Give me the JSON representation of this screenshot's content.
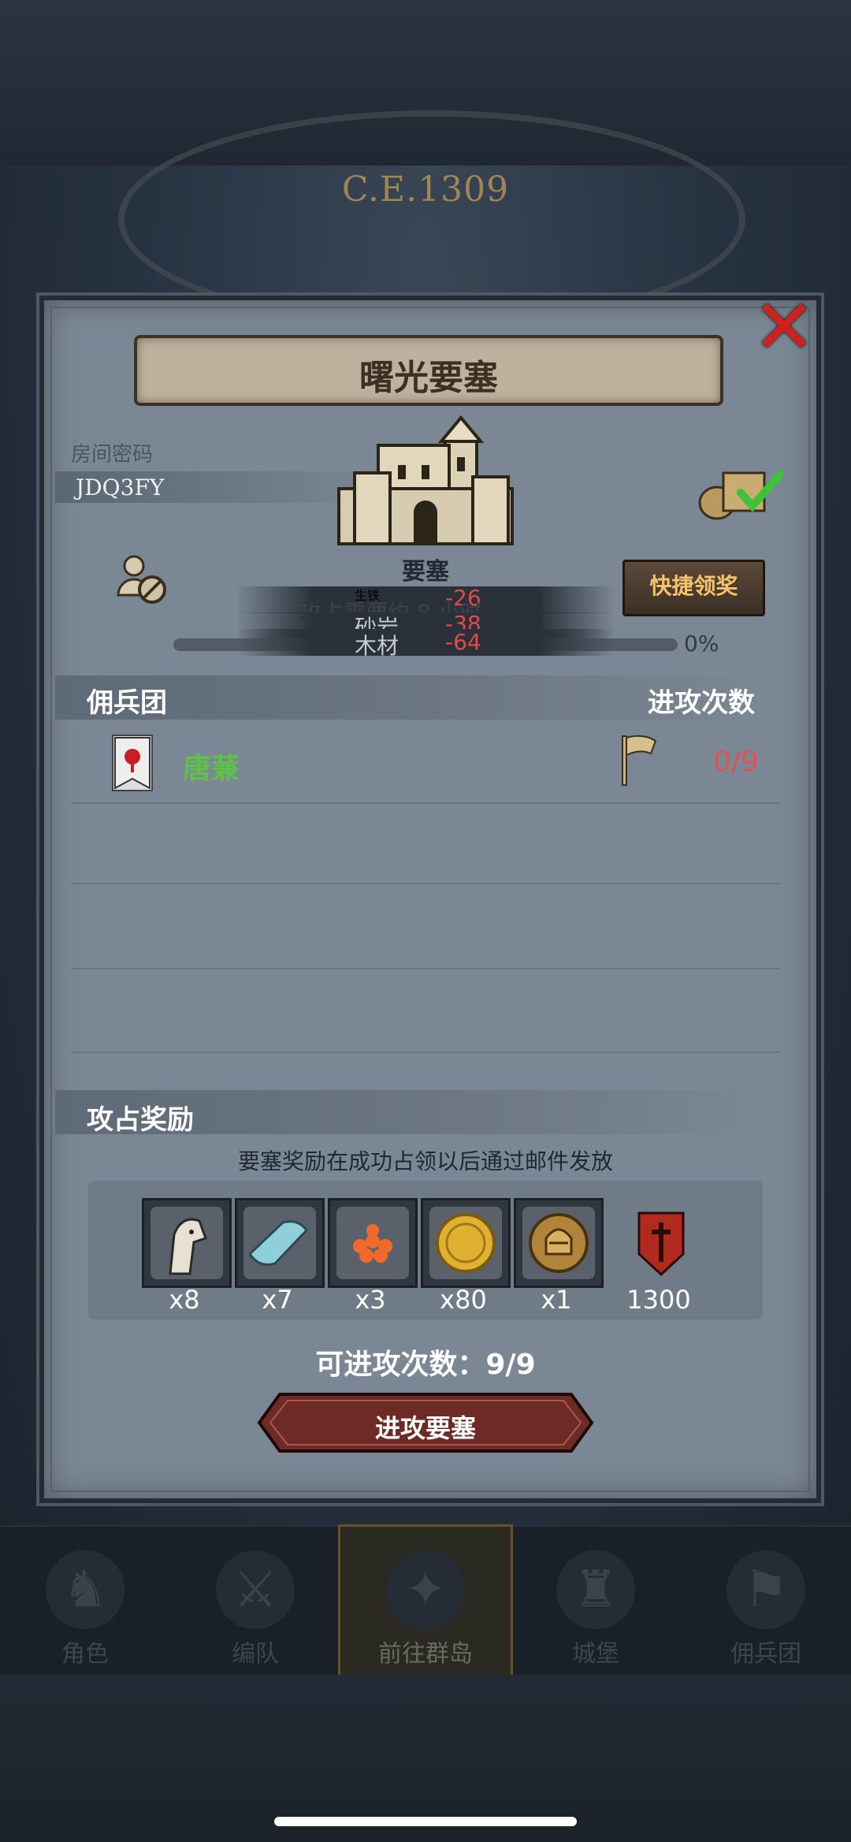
{
  "background": {
    "era": "C.E.1309"
  },
  "dialog": {
    "title": "曙光要塞",
    "room_label": "房间密码",
    "room_code": "JDQ3FY",
    "fortress_label": "要塞",
    "quick_claim_label": "快捷领奖",
    "progress_percent": "0%",
    "progress_value": 0,
    "resources": [
      {
        "name": "生铁",
        "value": "-26"
      },
      {
        "name": "砂岩",
        "value": "-38"
      },
      {
        "name": "木材",
        "value": "-64"
      }
    ],
    "status_overlay": "攻占需要约 8 小时"
  },
  "mercenary": {
    "section_title": "佣兵团",
    "attack_count_title": "进攻次数",
    "entries": [
      {
        "name": "唐蒹",
        "attacks": "0/9"
      }
    ]
  },
  "rewards": {
    "section_title": "攻占奖励",
    "note": "要塞奖励在成功占领以后通过邮件发放",
    "items": [
      {
        "icon": "horse-icon",
        "count": "x8"
      },
      {
        "icon": "cloth-icon",
        "count": "x7"
      },
      {
        "icon": "berries-icon",
        "count": "x3"
      },
      {
        "icon": "gold-coin-icon",
        "count": "x80"
      },
      {
        "icon": "helmet-coin-icon",
        "count": "x1"
      },
      {
        "icon": "guild-shield-icon",
        "count": "1300"
      }
    ],
    "available_attacks": "可进攻次数：9/9",
    "attack_button": "进攻要塞"
  },
  "nav": {
    "items": [
      {
        "label": "角色",
        "active": false
      },
      {
        "label": "编队",
        "active": false
      },
      {
        "label": "前往群岛",
        "active": true
      },
      {
        "label": "城堡",
        "active": false
      },
      {
        "label": "佣兵团",
        "active": false
      }
    ]
  },
  "colors": {
    "accent_gold": "#f4c36a",
    "danger_red": "#e05252",
    "mercenary_green": "#5ec24a"
  }
}
